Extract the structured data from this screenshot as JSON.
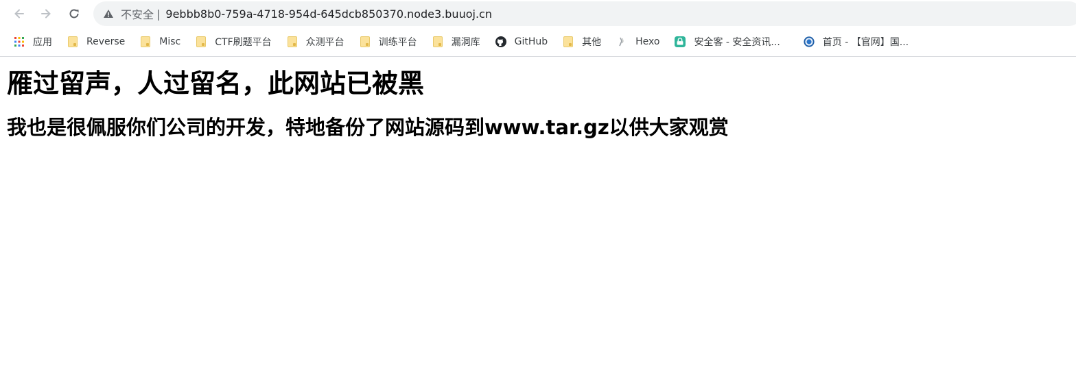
{
  "browser": {
    "security_label": "不安全",
    "separator": "|",
    "url": "9ebbb8b0-759a-4718-954d-645dcb850370.node3.buuoj.cn"
  },
  "bookmarks": [
    {
      "label": "应用",
      "icon": "apps-grid-icon"
    },
    {
      "label": "Reverse",
      "icon": "folder-icon"
    },
    {
      "label": "Misc",
      "icon": "folder-icon"
    },
    {
      "label": "CTF刷题平台",
      "icon": "folder-icon"
    },
    {
      "label": "众测平台",
      "icon": "folder-icon"
    },
    {
      "label": "训练平台",
      "icon": "folder-icon"
    },
    {
      "label": "漏洞库",
      "icon": "folder-icon"
    },
    {
      "label": "GitHub",
      "icon": "github-icon"
    },
    {
      "label": "其他",
      "icon": "folder-icon"
    },
    {
      "label": "Hexo",
      "icon": "hexo-icon"
    },
    {
      "label": "安全客 - 安全资讯...",
      "icon": "anquanke-icon"
    },
    {
      "label": "首页 - 【官网】国...",
      "icon": "globe-seal-icon"
    }
  ],
  "page": {
    "heading": "雁过留声，人过留名，此网站已被黑",
    "subheading": "我也是很佩服你们公司的开发，特地备份了网站源码到www.tar.gz以供大家观赏"
  },
  "colors": {
    "chrome_bg": "#ffffff",
    "omnibox_bg": "#f1f3f4",
    "folder": "#fbe29b",
    "text": "#000000"
  }
}
